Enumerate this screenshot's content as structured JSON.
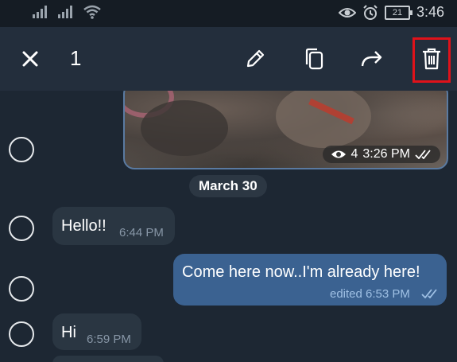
{
  "statusbar": {
    "time": "3:46",
    "battery": "21"
  },
  "actionbar": {
    "selected_count": "1",
    "icons": [
      "close-icon",
      "edit-icon",
      "copy-icon",
      "forward-icon",
      "delete-icon"
    ],
    "highlight_color": "#e0121a"
  },
  "photo_message": {
    "views": "4",
    "time": "3:26 PM"
  },
  "date_divider": "March 30",
  "messages": [
    {
      "direction": "in",
      "text": "Hello!!",
      "time": "6:44 PM"
    },
    {
      "direction": "out",
      "text": "Come here now..I'm already here!",
      "time": "edited 6:53 PM"
    },
    {
      "direction": "in",
      "text": "Hi",
      "time": "6:59 PM"
    }
  ],
  "colors": {
    "background": "#1d2733",
    "action_bar": "#232e3c",
    "incoming_bubble": "#2a3642",
    "outgoing_bubble": "#3b6291"
  }
}
